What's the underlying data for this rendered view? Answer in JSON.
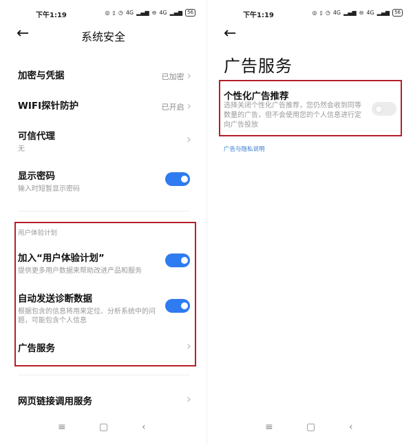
{
  "left": {
    "status": {
      "time": "下午1:19",
      "network": "4G",
      "battery": "56"
    },
    "title": "系统安全",
    "rows": {
      "encrypt": {
        "label": "加密与凭据",
        "value": "已加密"
      },
      "wifi": {
        "label": "WIFI探针防护",
        "value": "已开启"
      },
      "trusted": {
        "label": "可信代理",
        "sub": "无"
      },
      "showpw": {
        "label": "显示密码",
        "sub": "输入时短暂显示密码",
        "toggle_on": true
      }
    },
    "section_label": "用户体验计划",
    "ux": {
      "label": "加入“用户体验计划”",
      "sub": "提供更多用户数据来帮助改进产品和服务",
      "toggle_on": true
    },
    "diag": {
      "label": "自动发送诊断数据",
      "sub": "根据包含的信息将用来定位、分析系统中的问题，可能包含个人信息",
      "toggle_on": true
    },
    "ads": {
      "label": "广告服务"
    },
    "web": {
      "label": "网页链接调用服务"
    }
  },
  "right": {
    "status": {
      "time": "下午1:19",
      "network": "4G",
      "battery": "56"
    },
    "title": "广告服务",
    "personalized": {
      "label": "个性化广告推荐",
      "desc": "选择关闭个性化广告推荐，您仍然会收到同等数量的广告，但不会使用您的个人信息进行定向广告投放",
      "toggle_on": false
    },
    "privacy_link": "广告与隐私说明"
  },
  "icons": {
    "back": "back-arrow-icon",
    "chevron": "chevron-right-icon",
    "nav": [
      "menu-icon",
      "home-icon",
      "back-icon"
    ]
  },
  "colors": {
    "accent": "#2f7bf0",
    "highlight_box": "#b41e28",
    "link": "#3a7ecf"
  }
}
